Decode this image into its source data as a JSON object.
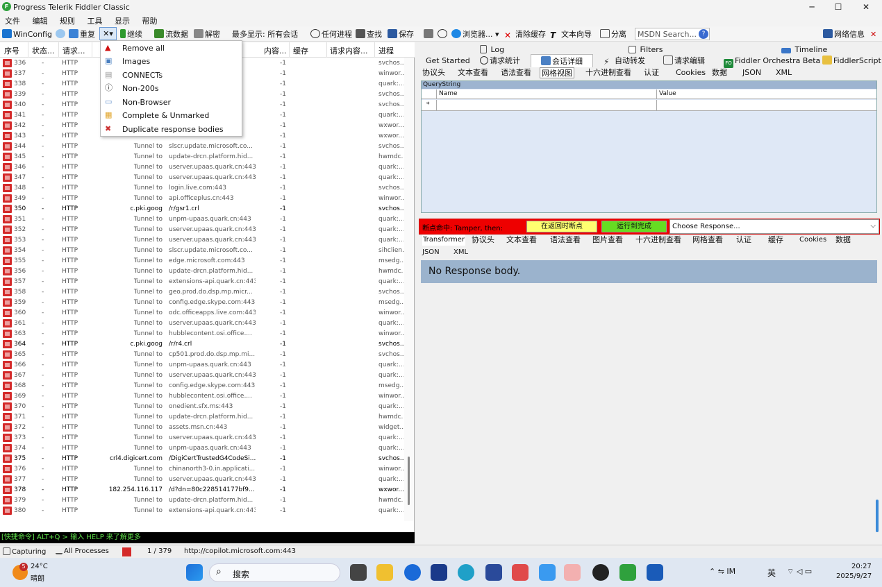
{
  "window": {
    "title": "Progress Telerik Fiddler Classic",
    "logo_glyph": "F",
    "minimize": "─",
    "maximize": "☐",
    "close": "✕"
  },
  "menu": [
    "文件",
    "编辑",
    "规则",
    "工具",
    "显示",
    "帮助"
  ],
  "toolbar": {
    "winconfig": "WinConfig",
    "replay": "重复",
    "remove_arrow": "✕▾",
    "resume": "继续",
    "stream": "流数据",
    "decode": "解密",
    "keep_label": "最多显示: 所有会话",
    "any_process": "任何进程",
    "find": "查找",
    "save": "保存",
    "browse": "浏览器...",
    "clear_cache": "清除缓存",
    "text_wizard": "文本向导",
    "tearoff": "分离",
    "search_placeholder": "MSDN Search...",
    "network_info": "网络信息",
    "close_x": "✕"
  },
  "columns": [
    "序号",
    "状态...",
    "请求...",
    "内容...",
    "缓存",
    "请求内容...",
    "进程"
  ],
  "sessions": [
    {
      "n": "336",
      "proto": "HTTP",
      "host": "",
      "url": "",
      "len": "-1",
      "proc": "svchos..."
    },
    {
      "n": "337",
      "proto": "HTTP",
      "host": "",
      "url": "",
      "len": "-1",
      "proc": "winwor..."
    },
    {
      "n": "338",
      "proto": "HTTP",
      "host": "",
      "url": "443",
      "len": "-1",
      "proc": "quark:..."
    },
    {
      "n": "339",
      "proto": "HTTP",
      "host": "",
      "url": "i...",
      "len": "-1",
      "proc": "svchos..."
    },
    {
      "n": "340",
      "proto": "HTTP",
      "host": "",
      "url": "",
      "len": "-1",
      "proc": "svchos..."
    },
    {
      "n": "341",
      "proto": "HTTP",
      "host": "",
      "url": "443",
      "len": "-1",
      "proc": "quark:..."
    },
    {
      "n": "342",
      "proto": "HTTP",
      "host": "",
      "url": "",
      "len": "-1",
      "proc": "wxwor..."
    },
    {
      "n": "343",
      "proto": "HTTP",
      "host": "",
      "url": "",
      "len": "-1",
      "proc": "wxwor..."
    },
    {
      "n": "344",
      "proto": "HTTP",
      "host": "Tunnel to",
      "url": "slscr.update.microsoft.co...",
      "len": "-1",
      "proc": "svchos..."
    },
    {
      "n": "345",
      "proto": "HTTP",
      "host": "Tunnel to",
      "url": "update-drcn.platform.hid...",
      "len": "-1",
      "proc": "hwmdc..."
    },
    {
      "n": "346",
      "proto": "HTTP",
      "host": "Tunnel to",
      "url": "userver.upaas.quark.cn:443",
      "len": "-1",
      "proc": "quark:..."
    },
    {
      "n": "347",
      "proto": "HTTP",
      "host": "Tunnel to",
      "url": "userver.upaas.quark.cn:443",
      "len": "-1",
      "proc": "quark:..."
    },
    {
      "n": "348",
      "proto": "HTTP",
      "host": "Tunnel to",
      "url": "login.live.com:443",
      "len": "-1",
      "proc": "svchos..."
    },
    {
      "n": "349",
      "proto": "HTTP",
      "host": "Tunnel to",
      "url": "api.officeplus.cn:443",
      "len": "-1",
      "proc": "winwor..."
    },
    {
      "n": "350",
      "proto": "HTTP",
      "host": "c.pki.goog",
      "url": "/r/gsr1.crl",
      "len": "-1",
      "proc": "svchos...",
      "dark": true
    },
    {
      "n": "351",
      "proto": "HTTP",
      "host": "Tunnel to",
      "url": "unpm-upaas.quark.cn:443",
      "len": "-1",
      "proc": "quark:..."
    },
    {
      "n": "352",
      "proto": "HTTP",
      "host": "Tunnel to",
      "url": "userver.upaas.quark.cn:443",
      "len": "-1",
      "proc": "quark:..."
    },
    {
      "n": "353",
      "proto": "HTTP",
      "host": "Tunnel to",
      "url": "userver.upaas.quark.cn:443",
      "len": "-1",
      "proc": "quark:..."
    },
    {
      "n": "354",
      "proto": "HTTP",
      "host": "Tunnel to",
      "url": "slscr.update.microsoft.co...",
      "len": "-1",
      "proc": "sihclien..."
    },
    {
      "n": "355",
      "proto": "HTTP",
      "host": "Tunnel to",
      "url": "edge.microsoft.com:443",
      "len": "-1",
      "proc": "msedg..."
    },
    {
      "n": "356",
      "proto": "HTTP",
      "host": "Tunnel to",
      "url": "update-drcn.platform.hid...",
      "len": "-1",
      "proc": "hwmdc..."
    },
    {
      "n": "357",
      "proto": "HTTP",
      "host": "Tunnel to",
      "url": "extensions-api.quark.cn:443",
      "len": "-1",
      "proc": "quark:..."
    },
    {
      "n": "358",
      "proto": "HTTP",
      "host": "Tunnel to",
      "url": "geo.prod.do.dsp.mp.micr...",
      "len": "-1",
      "proc": "svchos..."
    },
    {
      "n": "359",
      "proto": "HTTP",
      "host": "Tunnel to",
      "url": "config.edge.skype.com:443",
      "len": "-1",
      "proc": "msedg..."
    },
    {
      "n": "360",
      "proto": "HTTP",
      "host": "Tunnel to",
      "url": "odc.officeapps.live.com:443",
      "len": "-1",
      "proc": "winwor..."
    },
    {
      "n": "361",
      "proto": "HTTP",
      "host": "Tunnel to",
      "url": "userver.upaas.quark.cn:443",
      "len": "-1",
      "proc": "quark:..."
    },
    {
      "n": "363",
      "proto": "HTTP",
      "host": "Tunnel to",
      "url": "hubblecontent.osi.office....",
      "len": "-1",
      "proc": "winwor..."
    },
    {
      "n": "364",
      "proto": "HTTP",
      "host": "c.pki.goog",
      "url": "/r/r4.crl",
      "len": "-1",
      "proc": "svchos...",
      "dark": true
    },
    {
      "n": "365",
      "proto": "HTTP",
      "host": "Tunnel to",
      "url": "cp501.prod.do.dsp.mp.mi...",
      "len": "-1",
      "proc": "svchos..."
    },
    {
      "n": "366",
      "proto": "HTTP",
      "host": "Tunnel to",
      "url": "unpm-upaas.quark.cn:443",
      "len": "-1",
      "proc": "quark:..."
    },
    {
      "n": "367",
      "proto": "HTTP",
      "host": "Tunnel to",
      "url": "userver.upaas.quark.cn:443",
      "len": "-1",
      "proc": "quark:..."
    },
    {
      "n": "368",
      "proto": "HTTP",
      "host": "Tunnel to",
      "url": "config.edge.skype.com:443",
      "len": "-1",
      "proc": "msedg..."
    },
    {
      "n": "369",
      "proto": "HTTP",
      "host": "Tunnel to",
      "url": "hubblecontent.osi.office....",
      "len": "-1",
      "proc": "winwor..."
    },
    {
      "n": "370",
      "proto": "HTTP",
      "host": "Tunnel to",
      "url": "onedient.sfx.ms:443",
      "len": "-1",
      "proc": "quark:..."
    },
    {
      "n": "371",
      "proto": "HTTP",
      "host": "Tunnel to",
      "url": "update-drcn.platform.hid...",
      "len": "-1",
      "proc": "hwmdc..."
    },
    {
      "n": "372",
      "proto": "HTTP",
      "host": "Tunnel to",
      "url": "assets.msn.cn:443",
      "len": "-1",
      "proc": "widget..."
    },
    {
      "n": "373",
      "proto": "HTTP",
      "host": "Tunnel to",
      "url": "userver.upaas.quark.cn:443",
      "len": "-1",
      "proc": "quark:..."
    },
    {
      "n": "374",
      "proto": "HTTP",
      "host": "Tunnel to",
      "url": "unpm-upaas.quark.cn:443",
      "len": "-1",
      "proc": "quark:..."
    },
    {
      "n": "375",
      "proto": "HTTP",
      "host": "crl4.digicert.com",
      "url": "/DigiCertTrustedG4CodeSi...",
      "len": "-1",
      "proc": "svchos...",
      "dark": true
    },
    {
      "n": "376",
      "proto": "HTTP",
      "host": "Tunnel to",
      "url": "chinanorth3-0.in.applicati...",
      "len": "-1",
      "proc": "winwor..."
    },
    {
      "n": "377",
      "proto": "HTTP",
      "host": "Tunnel to",
      "url": "userver.upaas.quark.cn:443",
      "len": "-1",
      "proc": "quark:..."
    },
    {
      "n": "378",
      "proto": "HTTP",
      "host": "182.254.116.117",
      "url": "/d?dn=80c228514177bf9...",
      "len": "-1",
      "proc": "wxwor...",
      "dark": true
    },
    {
      "n": "379",
      "proto": "HTTP",
      "host": "Tunnel to",
      "url": "update-drcn.platform.hid...",
      "len": "-1",
      "proc": "hwmdc..."
    },
    {
      "n": "380",
      "proto": "HTTP",
      "host": "Tunnel to",
      "url": "extensions-api.quark.cn:443",
      "len": "-1",
      "proc": "quark:..."
    }
  ],
  "dropdown": [
    {
      "label": "Remove all",
      "icon": "warning-icon",
      "color": "#d01010"
    },
    {
      "label": "Images",
      "icon": "image-icon",
      "color": "#4a7fc0"
    },
    {
      "label": "CONNECTs",
      "icon": "lock-icon",
      "color": "#999999"
    },
    {
      "label": "Non-200s",
      "icon": "info-icon",
      "color": "#333333"
    },
    {
      "label": "Non-Browser",
      "icon": "window-icon",
      "color": "#5a8ac8"
    },
    {
      "label": "Complete & Unmarked",
      "icon": "grid-icon",
      "color": "#e0a020"
    },
    {
      "label": "Duplicate response bodies",
      "icon": "duplicate-icon",
      "color": "#cc3333"
    }
  ],
  "command_bar": "[快捷命令] ALT+Q > 输入 HELP 来了解更多",
  "status": {
    "capturing": "Capturing",
    "processes": "All Processes",
    "count": "1 / 379",
    "url": "http://copilot.microsoft.com:443"
  },
  "right": {
    "top_tabs": [
      "Log",
      "Filters",
      "Timeline"
    ],
    "tabs2": [
      "Get Started",
      "请求统计",
      "会话详细",
      "自动转发",
      "请求编辑",
      "Fiddler Orchestra Beta",
      "FiddlerScript"
    ],
    "req_tabs": [
      "协议头",
      "文本查看",
      "语法查看",
      "网格视图",
      "十六进制查看",
      "认证",
      "Cookies",
      "数据",
      "JSON",
      "XML"
    ],
    "grid_title": "QueryString",
    "grid_cols": [
      "Name",
      "Value"
    ],
    "grid_row_marker": "*",
    "breakpoint_label": "断点命中: Tamper, then:",
    "break_resp_btn": "在返回时断点",
    "run_btn": "运行到完成",
    "choose_placeholder": "Choose Response...",
    "resp_tabs": [
      "Transformer",
      "协议头",
      "文本查看",
      "语法查看",
      "图片查看",
      "十六进制查看",
      "网格查看",
      "认证",
      "缓存",
      "Cookies",
      "数据"
    ],
    "resp_tabs2": [
      "JSON",
      "XML"
    ],
    "no_response": "No Response body."
  },
  "taskbar": {
    "weather_badge": "5",
    "temp": "24°C",
    "weather": "晴朗",
    "search": "搜索",
    "time": "20:27",
    "date": "2025/9/27",
    "lang": "英",
    "sys_glyphs": "⌃  ⇋  IM  "
  },
  "colors": {
    "accent": "#2fa13d",
    "breakpoint_red": "#ee0000",
    "yellow_btn": "#ffff70",
    "green_btn": "#66dd22",
    "cmd_green": "#5fe04b"
  }
}
